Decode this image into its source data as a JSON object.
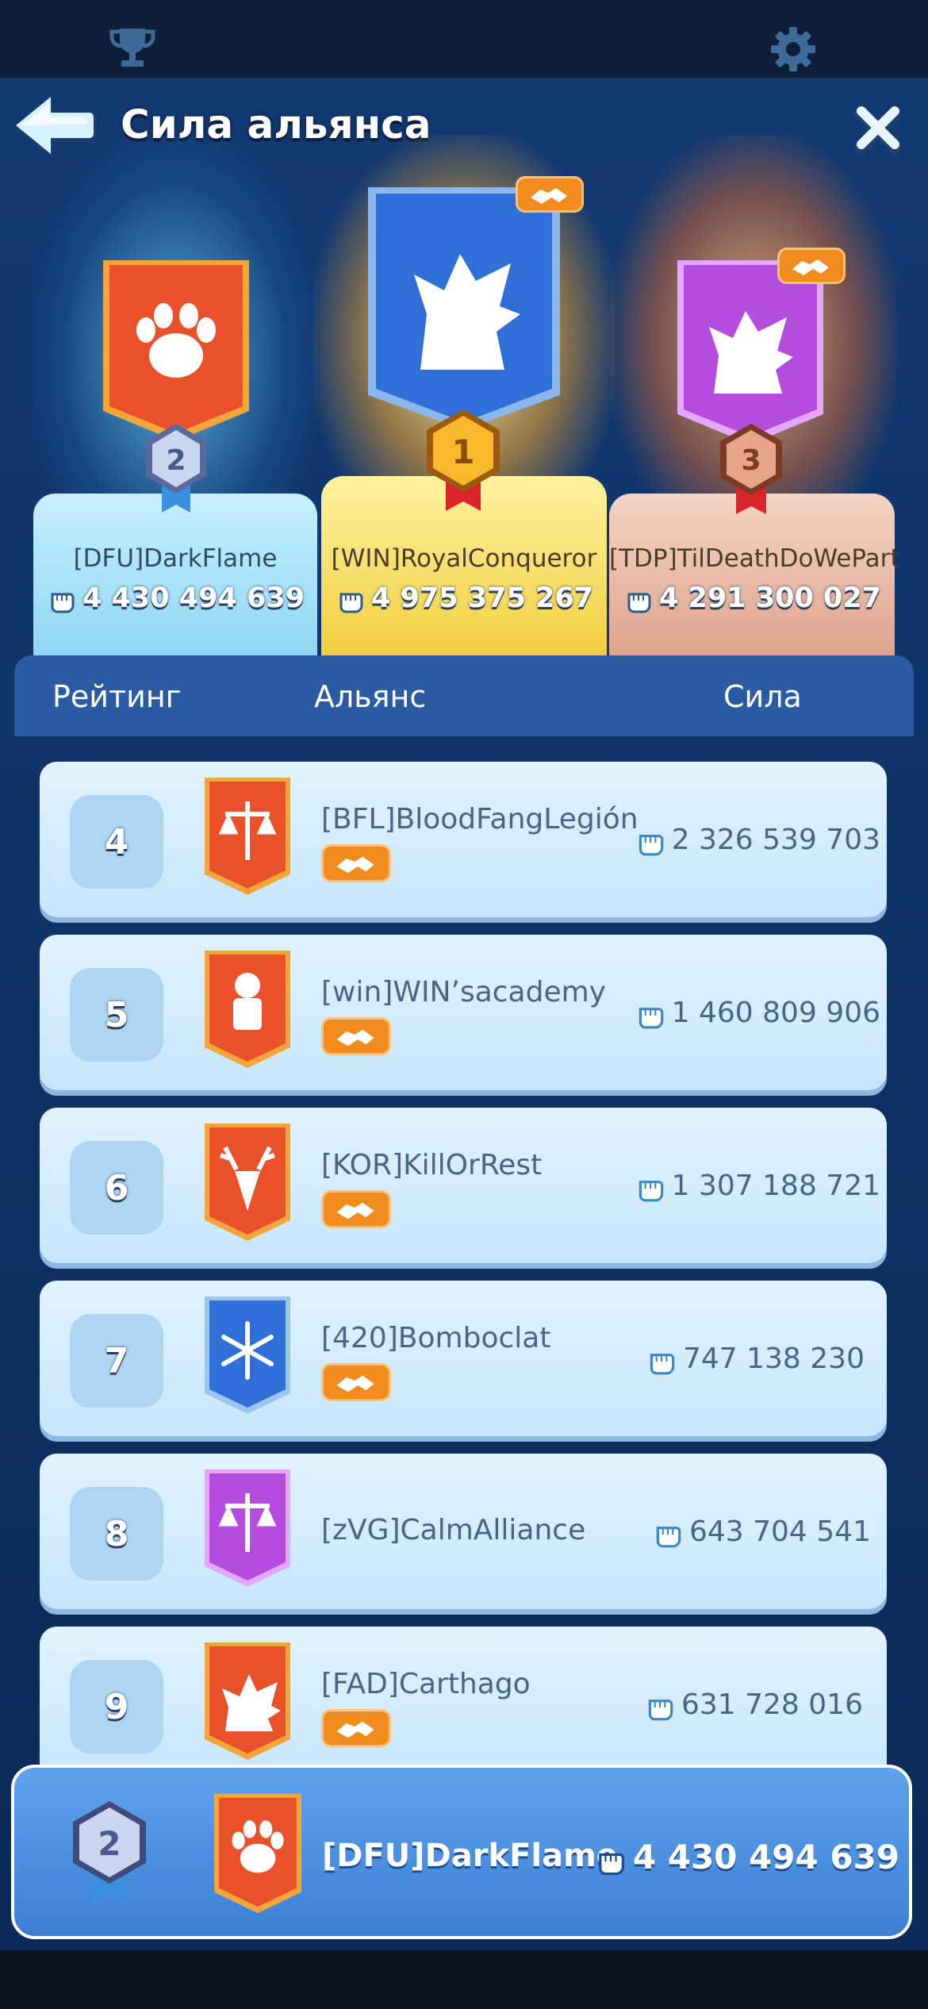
{
  "header": {
    "title": "Сила альянса"
  },
  "icons": {
    "top_left": "trophy-icon",
    "top_right": "gear-icon",
    "back": "back-arrow-icon",
    "close": "close-icon",
    "power": "fist-icon",
    "ally": "handshake-icon"
  },
  "podium": [
    {
      "rank": "2",
      "name": "[DFU]DarkFlame",
      "power": "4 430 494 639",
      "emblem": "paw-icon",
      "banner_color": "#e8512a"
    },
    {
      "rank": "1",
      "name": "[WIN]RoyalConqueror",
      "power": "4 975 375 267",
      "emblem": "wolf-icon",
      "banner_color": "#2f6fd8"
    },
    {
      "rank": "3",
      "name": "[TDP]TilDeathDoWePart",
      "power": "4 291 300 027",
      "emblem": "wolf-icon",
      "banner_color": "#b64be0"
    }
  ],
  "table": {
    "columns": {
      "rank": "Рейтинг",
      "alliance": "Альянс",
      "power": "Сила"
    },
    "rows": [
      {
        "rank": "4",
        "name": "[BFL]BloodFangLegión",
        "power": "2 326 539 703",
        "ally": true,
        "emblem": "scales-icon",
        "banner_color": "#e8512a"
      },
      {
        "rank": "5",
        "name": "[win]WIN’sacademy",
        "power": "1 460 809 906",
        "ally": true,
        "emblem": "fist-emblem-icon",
        "banner_color": "#e8512a"
      },
      {
        "rank": "6",
        "name": "[KOR]KillOrRest",
        "power": "1 307 188 721",
        "ally": true,
        "emblem": "deer-icon",
        "banner_color": "#e8512a"
      },
      {
        "rank": "7",
        "name": "[420]Bomboclat",
        "power": "747 138 230",
        "ally": true,
        "emblem": "snowflake-icon",
        "banner_color": "#2f6fd8"
      },
      {
        "rank": "8",
        "name": "[zVG]CalmAlliance",
        "power": "643 704 541",
        "ally": false,
        "emblem": "scales-icon",
        "banner_color": "#b64be0"
      },
      {
        "rank": "9",
        "name": "[FAD]Carthago",
        "power": "631 728 016",
        "ally": true,
        "emblem": "wolf-icon",
        "banner_color": "#e8512a"
      }
    ]
  },
  "my_alliance": {
    "rank": "2",
    "name": "[DFU]DarkFlame",
    "power": "4 430 494 639",
    "emblem": "paw-icon"
  }
}
